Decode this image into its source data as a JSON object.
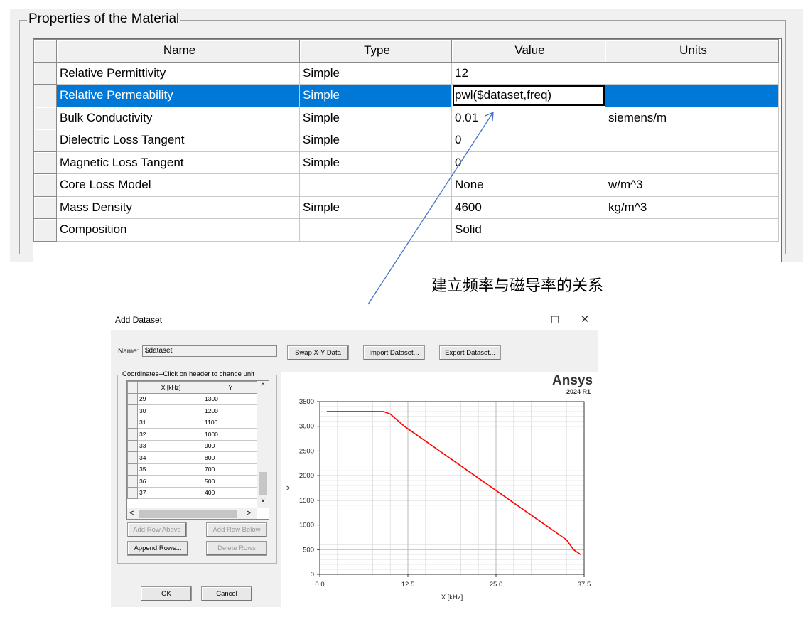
{
  "properties": {
    "group_title": "Properties of the Material",
    "columns": [
      "Name",
      "Type",
      "Value",
      "Units"
    ],
    "rows": [
      {
        "name": "Relative Permittivity",
        "type": "Simple",
        "value": "12",
        "units": ""
      },
      {
        "name": "Relative Permeability",
        "type": "Simple",
        "value": "pwl($dataset,freq)",
        "units": ""
      },
      {
        "name": "Bulk Conductivity",
        "type": "Simple",
        "value": "0.01",
        "units": "siemens/m"
      },
      {
        "name": "Dielectric Loss Tangent",
        "type": "Simple",
        "value": "0",
        "units": ""
      },
      {
        "name": "Magnetic Loss Tangent",
        "type": "Simple",
        "value": "0",
        "units": ""
      },
      {
        "name": "Core Loss Model",
        "type": "",
        "value": "None",
        "units": "w/m^3"
      },
      {
        "name": "Mass Density",
        "type": "Simple",
        "value": "4600",
        "units": "kg/m^3"
      },
      {
        "name": "Composition",
        "type": "",
        "value": "Solid",
        "units": ""
      }
    ],
    "selected_row": 1
  },
  "annotation": {
    "text": "建立频率与磁导率的关系"
  },
  "dialog": {
    "title": "Add Dataset",
    "window_buttons": {
      "minimize": "—",
      "maximize": "☐",
      "close": "✕"
    },
    "name_label": "Name:",
    "name_value": "$dataset",
    "buttons": {
      "swap": "Swap X-Y Data",
      "import": "Import Dataset...",
      "export": "Export Dataset...",
      "add_above": "Add Row Above",
      "add_below": "Add Row Below",
      "append": "Append Rows...",
      "delete": "Delete Rows",
      "ok": "OK",
      "cancel": "Cancel"
    },
    "coords_label": "Coordinates--Click on header to change unit",
    "table": {
      "columns": [
        "X [kHz]",
        "Y"
      ],
      "rows": [
        [
          "29",
          "1300"
        ],
        [
          "30",
          "1200"
        ],
        [
          "31",
          "1100"
        ],
        [
          "32",
          "1000"
        ],
        [
          "33",
          "900"
        ],
        [
          "34",
          "800"
        ],
        [
          "35",
          "700"
        ],
        [
          "36",
          "500"
        ],
        [
          "37",
          "400"
        ]
      ]
    },
    "scroll": {
      "up": "^",
      "down": "v",
      "left": "<",
      "right": ">"
    },
    "logo": {
      "brand": "Ansys",
      "version": "2024 R1"
    }
  },
  "chart_data": {
    "type": "line",
    "title": "",
    "xlabel": "X [kHz]",
    "ylabel": "Y",
    "xlim": [
      0,
      37.5
    ],
    "ylim": [
      0,
      3500
    ],
    "xticks": [
      "0.0",
      "12.5",
      "25.0",
      "37.5"
    ],
    "yticks": [
      "0",
      "500",
      "1000",
      "1500",
      "2000",
      "2500",
      "3000",
      "3500"
    ],
    "grid": true,
    "series": [
      {
        "color": "#ff0000",
        "x": [
          1,
          9,
          10,
          12,
          35,
          36,
          37
        ],
        "y": [
          3300,
          3300,
          3250,
          3000,
          700,
          500,
          400
        ]
      }
    ]
  }
}
